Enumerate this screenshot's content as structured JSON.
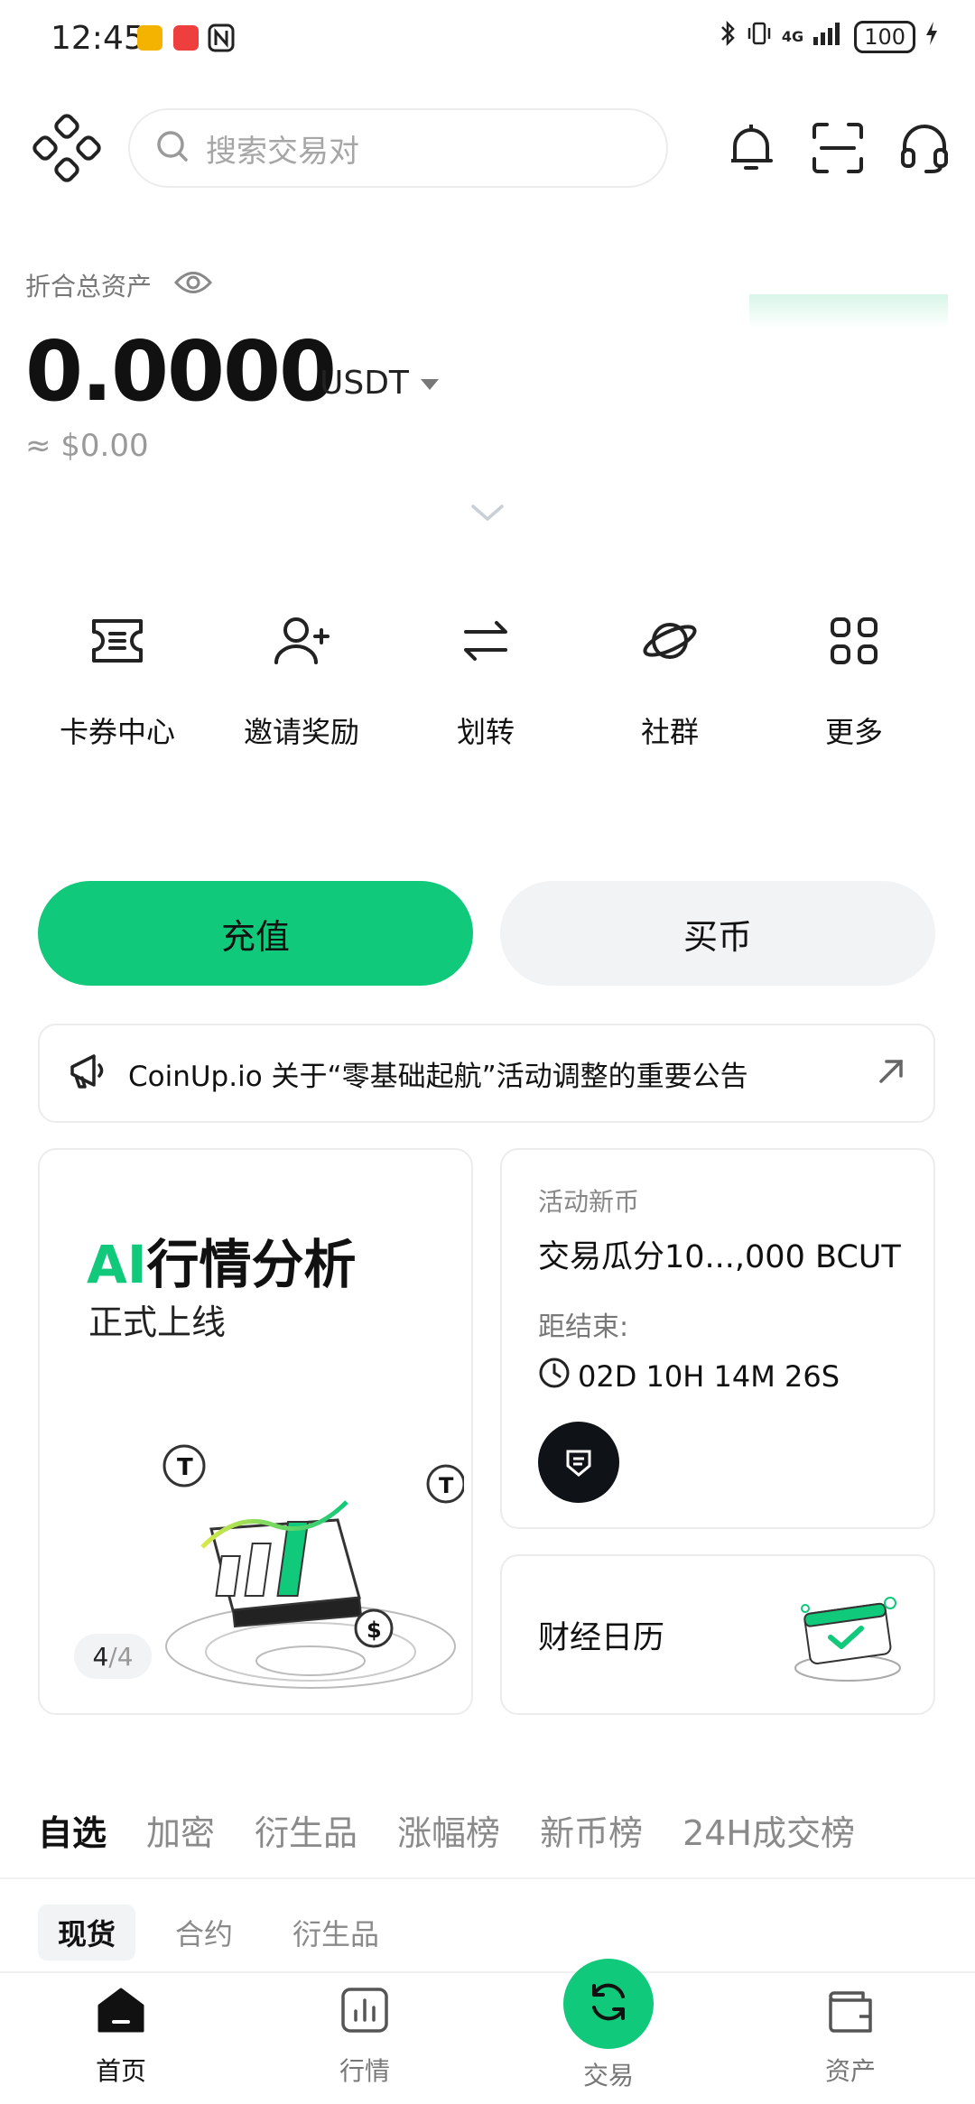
{
  "status_bar": {
    "time": "12:45",
    "network": "4G",
    "battery": "100"
  },
  "header": {
    "search_placeholder": "搜索交易对"
  },
  "assets": {
    "label": "折合总资产",
    "value": "0.0000",
    "unit": "USDT",
    "usd_equivalent": "≈ $0.00"
  },
  "quick_actions": [
    {
      "label": "卡券中心",
      "icon": "ticket-icon"
    },
    {
      "label": "邀请奖励",
      "icon": "invite-user-icon"
    },
    {
      "label": "划转",
      "icon": "transfer-icon"
    },
    {
      "label": "社群",
      "icon": "planet-icon"
    },
    {
      "label": "更多",
      "icon": "grid-icon"
    }
  ],
  "buttons": {
    "deposit": "充值",
    "buy": "买币"
  },
  "announcement": {
    "text": "CoinUp.io 关于“零基础起航”活动调整的重要公告"
  },
  "cards": {
    "ai": {
      "title_highlight": "AI",
      "title_rest": "行情分析",
      "subtitle": "正式上线",
      "pager_current": "4",
      "pager_total": "/4"
    },
    "event": {
      "tag": "活动新币",
      "title": "交易瓜分10...,000 BCUT",
      "ends_label": "距结束:",
      "countdown": "02D 10H 14M 26S"
    },
    "calendar": {
      "label": "财经日历"
    }
  },
  "market_tabs": [
    "自选",
    "加密",
    "衍生品",
    "涨幅榜",
    "新币榜",
    "24H成交榜"
  ],
  "sub_tabs": [
    "现货",
    "合约",
    "衍生品"
  ],
  "bottom_nav": {
    "home": "首页",
    "market": "行情",
    "trade": "交易",
    "assets": "资产"
  },
  "colors": {
    "accent": "#11c97a",
    "text": "#111111",
    "muted": "#8a8a8a"
  }
}
